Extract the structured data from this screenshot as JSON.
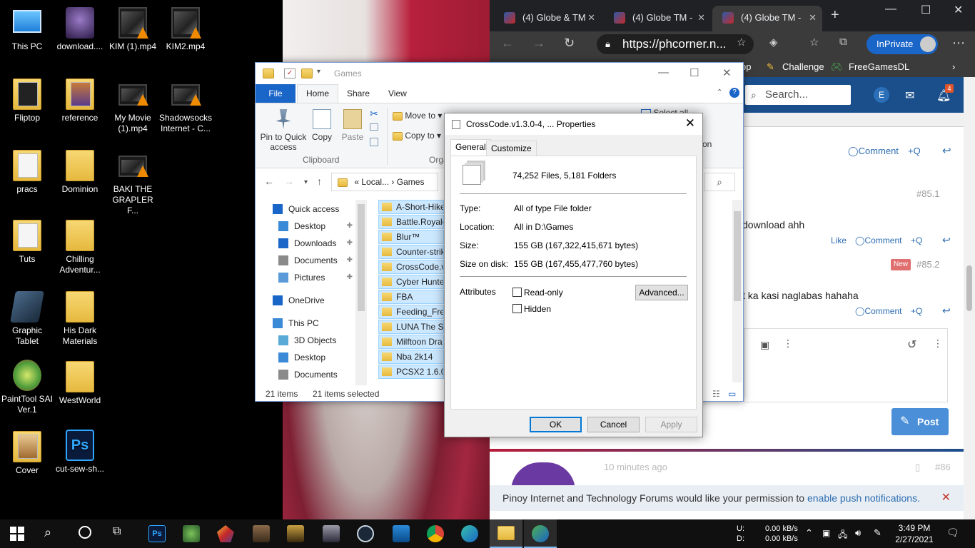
{
  "desktop_icons": [
    {
      "label": "This PC",
      "icon": "computer-icon"
    },
    {
      "label": "download....",
      "icon": "image-file-icon"
    },
    {
      "label": "KIM (1).mp4",
      "icon": "video-file-icon"
    },
    {
      "label": "KIM2.mp4",
      "icon": "video-file-icon"
    },
    {
      "label": "Fliptop",
      "icon": "folder-icon"
    },
    {
      "label": "reference",
      "icon": "folder-icon"
    },
    {
      "label": "My Movie (1).mp4",
      "icon": "video-file-icon"
    },
    {
      "label": "Shadowsocks Internet - C...",
      "icon": "video-file-icon"
    },
    {
      "label": "pracs",
      "icon": "folder-icon"
    },
    {
      "label": "Dominion",
      "icon": "folder-icon"
    },
    {
      "label": "BAKI THE GRAPLER F...",
      "icon": "video-file-icon"
    },
    {
      "label": "Tuts",
      "icon": "folder-icon"
    },
    {
      "label": "Chilling Adventur...",
      "icon": "folder-icon"
    },
    {
      "label": "Graphic Tablet",
      "icon": "tablet-shortcut-icon"
    },
    {
      "label": "His Dark Materials",
      "icon": "folder-icon"
    },
    {
      "label": "PaintTool SAI Ver.1",
      "icon": "painttool-icon"
    },
    {
      "label": "WestWorld",
      "icon": "folder-icon"
    },
    {
      "label": "Cover",
      "icon": "folder-icon"
    },
    {
      "label": "cut-sew-sh...",
      "icon": "photoshop-file-icon"
    }
  ],
  "browser": {
    "tabs": [
      {
        "label": "(4) Globe & TM"
      },
      {
        "label": "(4) Globe TM -"
      },
      {
        "label": "(4) Globe TM -"
      }
    ],
    "url": "https://phcorner.n...",
    "inprivate_label": "InPrivate",
    "favorites": [
      "op",
      "Challenge",
      "FreeGamesDL"
    ],
    "search_placeholder": "Search...",
    "notification_count": "4",
    "posts": {
      "comment_label": "Comment",
      "quote_label": "+Q",
      "like_label": "Like",
      "post85_1": "#85.1",
      "post85_1_text": "download ahh",
      "new_badge": "New",
      "post85_2": "#85.2",
      "post85_2_text": "t ka kasi naglabas hahaha",
      "post_button": "Post",
      "post86_time": "10 minutes ago",
      "post86": "#86"
    },
    "push_text": "Pinoy Internet and Technology Forums would like your permission to ",
    "push_link": "enable push notifications."
  },
  "explorer": {
    "title": "Games",
    "ribbon_tabs": {
      "file": "File",
      "home": "Home",
      "share": "Share",
      "view": "View"
    },
    "clipboard": {
      "pin": "Pin to Quick access",
      "copy": "Copy",
      "paste": "Paste",
      "group": "Clipboard"
    },
    "organize": {
      "move_to": "Move to",
      "copy_to": "Copy to",
      "group": "Orga"
    },
    "select_all": "Select all",
    "on_fragment": "on",
    "address": {
      "prefix": "«",
      "part1": "Local...",
      "part2": "Games"
    },
    "nav": [
      {
        "label": "Quick access",
        "indent": 0,
        "pinned": false,
        "icon": "star-icon"
      },
      {
        "label": "Desktop",
        "indent": 1,
        "pinned": true,
        "icon": "desktop-icon"
      },
      {
        "label": "Downloads",
        "indent": 1,
        "pinned": true,
        "icon": "download-arrow-icon"
      },
      {
        "label": "Documents",
        "indent": 1,
        "pinned": true,
        "icon": "documents-icon"
      },
      {
        "label": "Pictures",
        "indent": 1,
        "pinned": true,
        "icon": "pictures-icon"
      },
      {
        "label": "OneDrive",
        "indent": 0,
        "pinned": false,
        "icon": "cloud-icon"
      },
      {
        "label": "This PC",
        "indent": 0,
        "pinned": false,
        "icon": "computer-icon"
      },
      {
        "label": "3D Objects",
        "indent": 1,
        "pinned": false,
        "icon": "cube-icon"
      },
      {
        "label": "Desktop",
        "indent": 1,
        "pinned": false,
        "icon": "desktop-icon"
      },
      {
        "label": "Documents",
        "indent": 1,
        "pinned": false,
        "icon": "documents-icon"
      }
    ],
    "files": [
      "A-Short-Hike",
      "Battle.Royale",
      "Blur™",
      "Counter-strik",
      "CrossCode.v1",
      "Cyber Hunter",
      "FBA",
      "Feeding_Fren",
      "LUNA The Sh",
      "Milftoon Dra",
      "Nba 2k14",
      "PCSX2 1.6.0"
    ],
    "status_items": "21 items",
    "status_selected": "21 items selected"
  },
  "properties": {
    "title": "CrossCode.v1.3.0-4, ... Properties",
    "tabs": {
      "general": "General",
      "customize": "Customize"
    },
    "summary": "74,252 Files, 5,181 Folders",
    "type_label": "Type:",
    "type_value": "All of type File folder",
    "location_label": "Location:",
    "location_value": "All in D:\\Games",
    "size_label": "Size:",
    "size_value": "155 GB (167,322,415,671 bytes)",
    "size_on_disk_label": "Size on disk:",
    "size_on_disk_value": "155 GB (167,455,477,760 bytes)",
    "attributes_label": "Attributes",
    "readonly_label": "Read-only",
    "hidden_label": "Hidden",
    "advanced_label": "Advanced...",
    "ok": "OK",
    "cancel": "Cancel",
    "apply": "Apply"
  },
  "taskbar": {
    "drive_u": "U:",
    "drive_d": "D:",
    "net_up": "0.00 kB/s",
    "net_down": "0.00 kB/s",
    "time": "3:49 PM",
    "date": "2/27/2021"
  },
  "colors": {
    "accent": "#1a65c8",
    "forum_header": "#1b4f8c",
    "post_button": "#4a8fd8"
  }
}
